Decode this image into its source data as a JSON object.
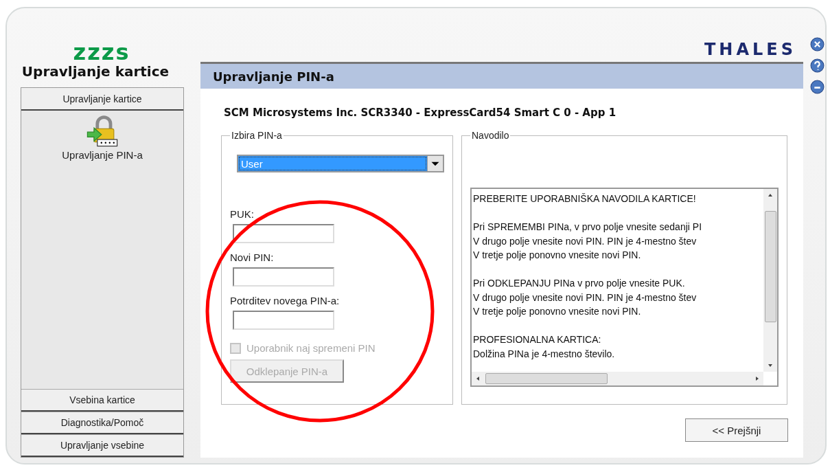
{
  "logo": {
    "mark": "zzzs",
    "title": "Upravljanje kartice"
  },
  "brand": "THALES",
  "window_controls": [
    {
      "kind": "close"
    },
    {
      "kind": "help"
    },
    {
      "kind": "minimize"
    }
  ],
  "sidebar": {
    "open_section": {
      "label": "Upravljanje kartice",
      "items": [
        {
          "label": "Upravljanje PIN-a"
        }
      ]
    },
    "other_sections": [
      {
        "label": "Vsebina kartice"
      },
      {
        "label": "Diagnostika/Pomoč"
      },
      {
        "label": "Upravljanje vsebine"
      }
    ]
  },
  "panel": {
    "title": "Upravljanje PIN-a",
    "device": "SCM Microsystems Inc. SCR3340 - ExpressCard54 Smart C 0 - App 1",
    "pin_group": {
      "legend": "Izbira PIN-a",
      "dropdown": {
        "value": "User"
      },
      "fields": [
        {
          "label": "PUK:"
        },
        {
          "label": "Novi PIN:"
        },
        {
          "label": "Potrditev novega PIN-a:"
        }
      ],
      "checkbox": {
        "label": "Uporabnik naj spremeni PIN",
        "checked": false,
        "disabled": true
      },
      "button": {
        "label": "Odklepanje PIN-a",
        "disabled": true
      }
    },
    "help_group": {
      "legend": "Navodilo",
      "paragraphs": [
        [
          "PREBERITE UPORABNIŠKA NAVODILA KARTICE!"
        ],
        [
          "Pri SPREMEMBI PINa, v prvo polje vnesite sedanji PI",
          "V drugo polje vnesite novi PIN. PIN je 4-mestno štev",
          "V tretje polje ponovno vnesite novi PIN."
        ],
        [
          "Pri ODKLEPANJU PINa v prvo polje vnesite PUK.",
          "V drugo polje vnesite novi PIN. PIN je 4-mestno štev",
          "V tretje polje ponovno vnesite novi PIN."
        ],
        [
          "PROFESIONALNA KARTICA:",
          "Dolžina PINa je 4-mestno število."
        ]
      ]
    },
    "back_button": "<< Prejšnji"
  },
  "annotation": {
    "kind": "circle"
  }
}
